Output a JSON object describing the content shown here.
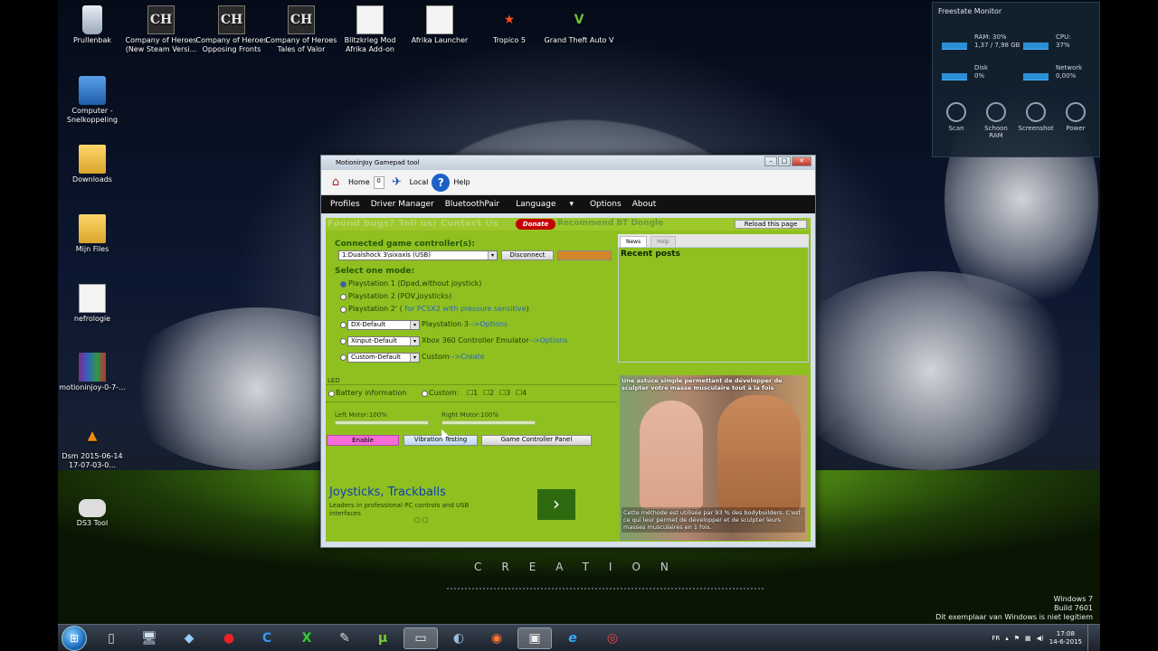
{
  "desktop": {
    "icons": [
      {
        "label": "Prullenbak",
        "icon": "recycle-bin-icon"
      },
      {
        "label": "Company of Heroes (New Steam Versi...",
        "icon": "coh-icon",
        "glyph": "CH"
      },
      {
        "label": "Company of Heroes Opposing Fronts",
        "icon": "coh-icon",
        "glyph": "CH"
      },
      {
        "label": "Company of Heroes Tales of Valor",
        "icon": "coh-icon",
        "glyph": "CH"
      },
      {
        "label": "Blitzkrieg Mod Afrika Add-on",
        "icon": "document-icon"
      },
      {
        "label": "Afrika Launcher",
        "icon": "document-icon"
      },
      {
        "label": "Tropico 5",
        "icon": "star-icon"
      },
      {
        "label": "Grand Theft Auto V",
        "icon": "gta-icon"
      },
      {
        "label": "Computer - Snelkoppeling",
        "icon": "computer-icon"
      },
      {
        "label": "Downloads",
        "icon": "folder-icon"
      },
      {
        "label": "Mijn Files",
        "icon": "folder-icon"
      },
      {
        "label": "nefrologie",
        "icon": "document-icon"
      },
      {
        "label": "motioninjoy-0-7-...",
        "icon": "archive-icon"
      },
      {
        "label": "Dsm 2015-06-14 17-07-03-0...",
        "icon": "vlc-icon"
      },
      {
        "label": "DS3 Tool",
        "icon": "gamepad-icon"
      }
    ],
    "watermark": "CREATION",
    "system_info": [
      "Windows 7",
      "Build 7601",
      "Dit exemplaar van Windows is niet legitiem"
    ]
  },
  "gadget": {
    "title": "Freestate Monitor",
    "metrics": [
      {
        "name": "RAM: 30%",
        "detail": "1,37 / 7,98 GB"
      },
      {
        "name": "CPU:",
        "detail": "37%"
      },
      {
        "name": "Disk",
        "detail": "0%"
      },
      {
        "name": "Network",
        "detail": "0,00%"
      }
    ],
    "buttons": [
      "Scan",
      "Schoon RAM",
      "Screenshot",
      "Power"
    ]
  },
  "app": {
    "title": "MotioninJoy Gamepad tool",
    "toolbar": {
      "home": "Home",
      "counter": "0",
      "local": "Local",
      "help": "Help"
    },
    "menu": [
      "Profiles",
      "Driver Manager",
      "BluetoothPair",
      "Language",
      "Options",
      "About"
    ],
    "banner": {
      "faded": "Found bugs? Tell us! Contact Us",
      "donate": "Donate",
      "recommend": "Recommend BT Dongle",
      "reload": "Reload this page"
    },
    "connected_title": "Connected game controller(s):",
    "controller": "1:Dualshock 3\\sixaxis (USB)",
    "disconnect": "Disconnect",
    "select_mode_title": "Select one mode:",
    "modes": [
      {
        "label": "Playstation 1 (Dpad,without joystick)",
        "selected": true
      },
      {
        "label": "Playstation 2 (POV,joysticks)",
        "selected": false
      },
      {
        "label": "Playstation 2' (",
        "link": "for PCSX2 with pressure sensitive",
        "suffix": ")",
        "selected": false
      },
      {
        "select": "DX-Default",
        "label": "Playstation 3",
        "link": "-->Options",
        "selected": false
      },
      {
        "select": "Xinput-Default",
        "label": "Xbox 360 Controller Emulator",
        "link": "-->Options",
        "selected": false
      },
      {
        "select": "Custom-Default",
        "label": "Custom",
        "link": "-->Create",
        "selected": false
      }
    ],
    "led_label": "LED",
    "battery": "Battery information",
    "custom": "Custom:",
    "custom_digits": [
      "1",
      "2",
      "3",
      "4"
    ],
    "left_motor": "Left Motor:100%",
    "right_motor": "Right Motor:100%",
    "enable": "Enable",
    "vibration": "Vibration Testing",
    "panel": "Game Controller Panel",
    "ad_left": {
      "title": "Joysticks, Trackballs",
      "sub": "Leaders in professional PC controls and USB interfaces",
      "arrow": "›"
    },
    "tabs": [
      "News",
      "Help"
    ],
    "recent_posts": "Recent posts",
    "ad_right": {
      "top": "Une astuce simple permettant de développer de sculpter votre masse musculaire tout à la fois",
      "bottom": "Cette méthode est utilisée par 93 % des bodybuilders. C'est ce qui leur permet de développer et de sculpter leurs masses musculaires en 1 fois."
    }
  },
  "taskbar": {
    "items": [
      {
        "icon": "start-orb-icon"
      },
      {
        "icon": "document-icon",
        "glyph": "▯"
      },
      {
        "icon": "computer-icon",
        "glyph": "🖥"
      },
      {
        "icon": "explorer-icon",
        "glyph": "◆"
      },
      {
        "icon": "record-icon",
        "glyph": "●"
      },
      {
        "icon": "ccleaner-icon",
        "glyph": "C"
      },
      {
        "icon": "excel-icon",
        "glyph": "X"
      },
      {
        "icon": "tool-icon",
        "glyph": "✎"
      },
      {
        "icon": "utorrent-icon",
        "glyph": "µ"
      },
      {
        "icon": "gamepad-icon",
        "glyph": "▭",
        "active": true
      },
      {
        "icon": "steam-icon",
        "glyph": "◐"
      },
      {
        "icon": "origin-icon",
        "glyph": "◉"
      },
      {
        "icon": "gamepad-icon",
        "glyph": "▣",
        "active": true
      },
      {
        "icon": "ie-icon",
        "glyph": "e"
      },
      {
        "icon": "chrome-icon",
        "glyph": "◎"
      }
    ],
    "tray": {
      "lang": "FR",
      "time": "17:08",
      "date": "14-6-2015"
    }
  }
}
